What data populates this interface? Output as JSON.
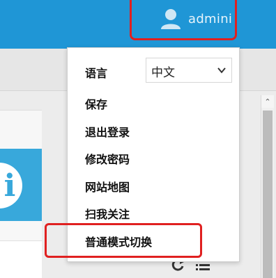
{
  "header": {
    "username": "admini",
    "user_icon": "user-icon",
    "color": "#1f96d6"
  },
  "dropdown": {
    "language_label": "语言",
    "language_select_value": "中文",
    "items": [
      {
        "label": "保存"
      },
      {
        "label": "退出登录"
      },
      {
        "label": "修改密码"
      },
      {
        "label": "网站地图"
      },
      {
        "label": "扫我关注"
      },
      {
        "label": "普通模式切换"
      }
    ]
  },
  "info_card": {
    "glyph": "i",
    "icon": "info-icon",
    "color": "#38a8db"
  },
  "scrollbar": {
    "up_arrow": "⌃"
  },
  "annotations": {
    "highlight_color": "#e02020"
  }
}
